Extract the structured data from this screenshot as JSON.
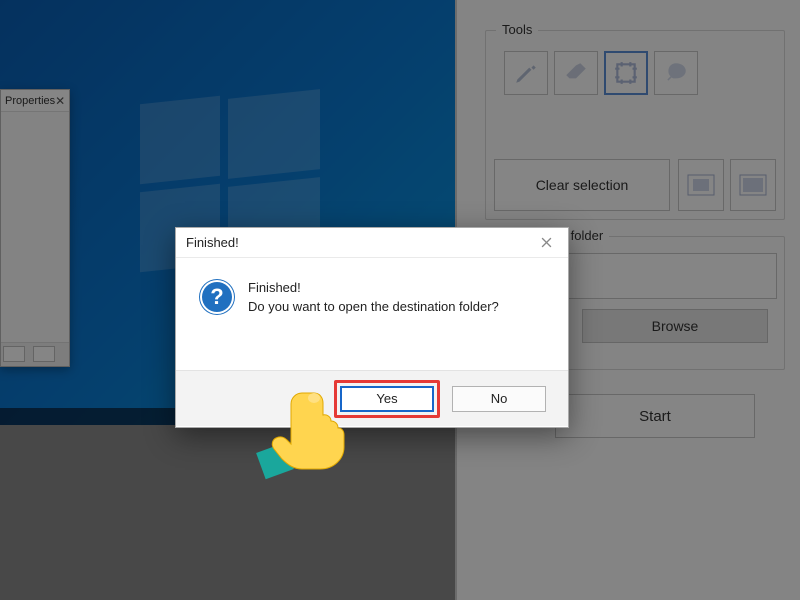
{
  "desktop": {
    "properties_title": "Properties"
  },
  "rightpanel": {
    "tools_legend": "Tools",
    "clear_selection_label": "Clear selection",
    "dest_legend": "Destination folder",
    "browse_label": "Browse",
    "start_label": "Start"
  },
  "dialog": {
    "title": "Finished!",
    "heading": "Finished!",
    "message": "Do you want to open the destination folder?",
    "yes_label": "Yes",
    "no_label": "No"
  }
}
